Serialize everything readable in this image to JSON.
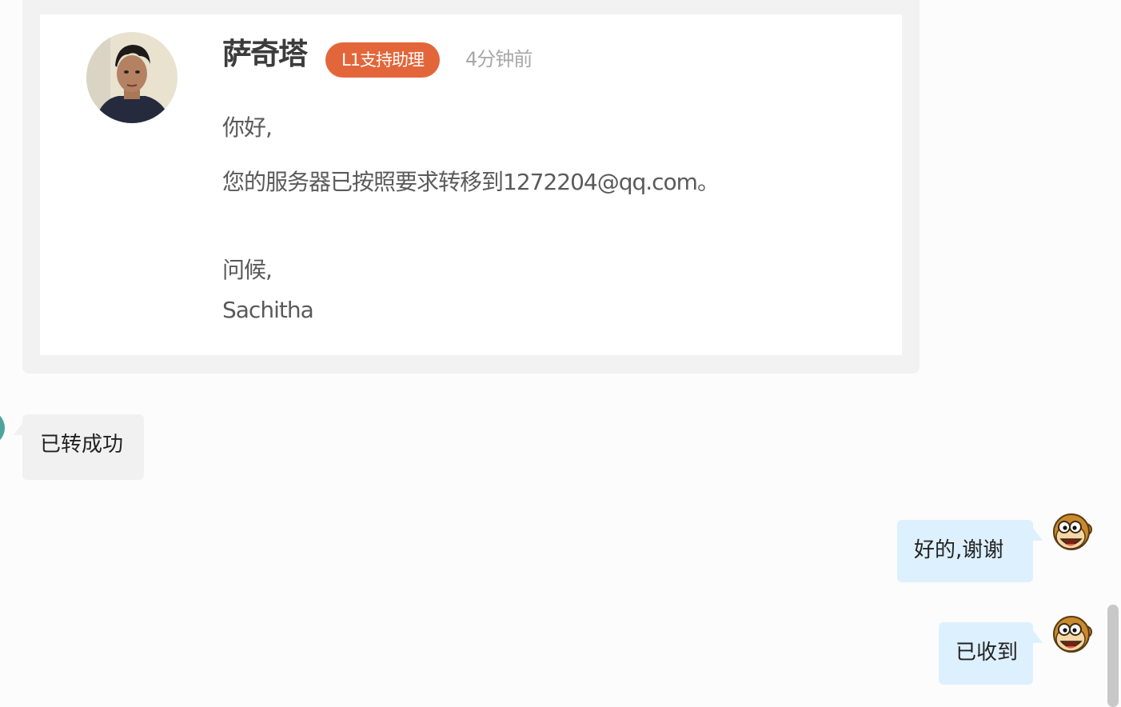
{
  "ticket_reply": {
    "agent_name": "萨奇塔",
    "role_badge": "L1支持助理",
    "time_ago": "4分钟前",
    "greeting": "你好,",
    "body": "您的服务器已按照要求转移到1272204@qq.com。",
    "closing": "问候,",
    "signature": "Sachitha",
    "badge_color": "#e3663a"
  },
  "messages": [
    {
      "side": "left",
      "text": "已转成功"
    },
    {
      "side": "right",
      "text": "好的,谢谢"
    },
    {
      "side": "right",
      "text": "已收到"
    }
  ],
  "icons": {
    "agent_avatar": "person-photo-avatar",
    "user_avatar": "monkey-face-avatar",
    "peer_avatar": "teal-avatar"
  },
  "colors": {
    "right_bubble": "#ddf0fd",
    "left_bubble": "#f1f1f1"
  }
}
